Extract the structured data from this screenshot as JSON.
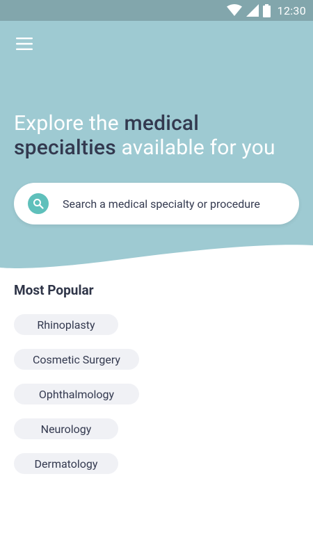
{
  "status_bar": {
    "time": "12:30",
    "icons": [
      "wifi-icon",
      "cell-signal-icon",
      "battery-icon"
    ]
  },
  "colors": {
    "status_bar": "#82a6ac",
    "hero": "#9ecad2",
    "accent": "#5fc0bb",
    "text_dark": "#33394f",
    "chip_bg": "#f0f1f5"
  },
  "header": {
    "menu_icon": "hamburger-menu-icon"
  },
  "hero": {
    "headline": {
      "part1": "Explore the ",
      "part2": "medical",
      "part3": "specialties",
      "part4": " available for you"
    }
  },
  "search": {
    "icon": "search-icon",
    "placeholder": "Search a medical specialty or procedure"
  },
  "popular": {
    "title": "Most Popular",
    "items": [
      {
        "label": "Rhinoplasty"
      },
      {
        "label": "Cosmetic Surgery"
      },
      {
        "label": "Ophthalmology"
      },
      {
        "label": "Neurology"
      },
      {
        "label": "Dermatology"
      }
    ]
  }
}
